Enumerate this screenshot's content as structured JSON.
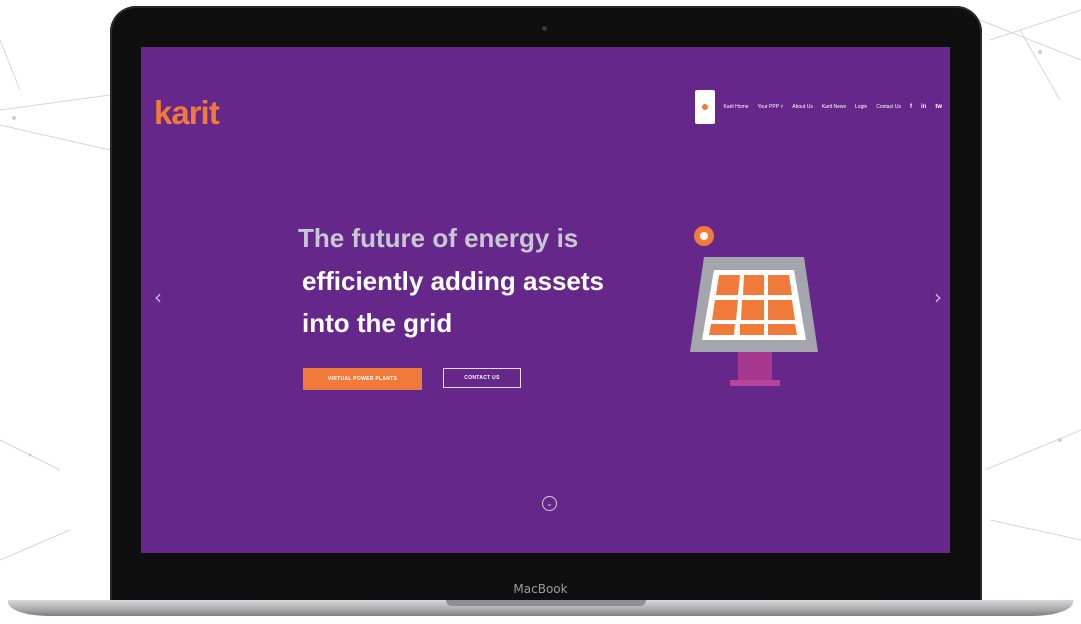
{
  "device": {
    "label": "MacBook"
  },
  "site": {
    "logo": "karit",
    "nav": {
      "items": [
        "Karit Home",
        "Your PPP ˅",
        "About Us",
        "Karit News",
        "Login",
        "Contact Us"
      ],
      "social": [
        "f",
        "in",
        "tw"
      ]
    },
    "hero": {
      "line1": "The future of energy is",
      "line2": "efficiently adding assets",
      "line3": "into the grid",
      "primary_button": "VIRTUAL POWER PLANTS",
      "secondary_button": "CONTACT US"
    },
    "carousel": {
      "prev_glyph": "‹",
      "next_glyph": "›"
    },
    "scroll_glyph": "⌄"
  },
  "colors": {
    "background_purple": "#66278a",
    "accent_orange": "#f07a3a",
    "panel_frame": "#a5a5ad",
    "stand_magenta": "#a8388d"
  },
  "icons": [
    "bolt-icon",
    "facebook-icon",
    "linkedin-icon",
    "twitter-icon",
    "chevron-left-icon",
    "chevron-right-icon",
    "scroll-down-icon",
    "solar-panel-illustration"
  ]
}
